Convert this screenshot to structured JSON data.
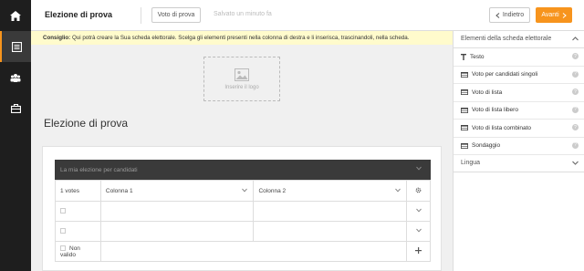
{
  "header": {
    "title": "Elezione di prova",
    "test_button": "Voto di prova",
    "saved_status": "Salvato un minuto fa",
    "back_button": "Indietro",
    "next_button": "Avanti"
  },
  "tip": {
    "label": "Consiglio:",
    "text": " Qui potrà creare la Sua scheda elettorale. Scelga gli elementi presenti nella colonna di destra e li inserisca, trascinandoli, nella scheda."
  },
  "logo": {
    "caption": "Inserire il logo"
  },
  "ballot": {
    "title": "Elezione di prova",
    "group_title": "La mia elezione per candidati",
    "votes_label": "1 votes",
    "column1": "Colonna 1",
    "column2": "Colonna 2",
    "invalid_label": "Non valido"
  },
  "sidebar": {
    "section_title": "Elementi della scheda elettorale",
    "items": [
      {
        "label": "Testo",
        "icon": "text-icon"
      },
      {
        "label": "Voto per candidati singoli",
        "icon": "table-icon"
      },
      {
        "label": "Voto di lista",
        "icon": "table-icon"
      },
      {
        "label": "Voto di lista libero",
        "icon": "table-icon"
      },
      {
        "label": "Voto di lista combinato",
        "icon": "table-icon"
      },
      {
        "label": "Sondaggio",
        "icon": "table-icon"
      }
    ],
    "language_section": "Lingua"
  },
  "colors": {
    "accent": "#f7941d",
    "sidebar_bg": "#1e1e1e",
    "tip_bg": "#fffbcc"
  }
}
